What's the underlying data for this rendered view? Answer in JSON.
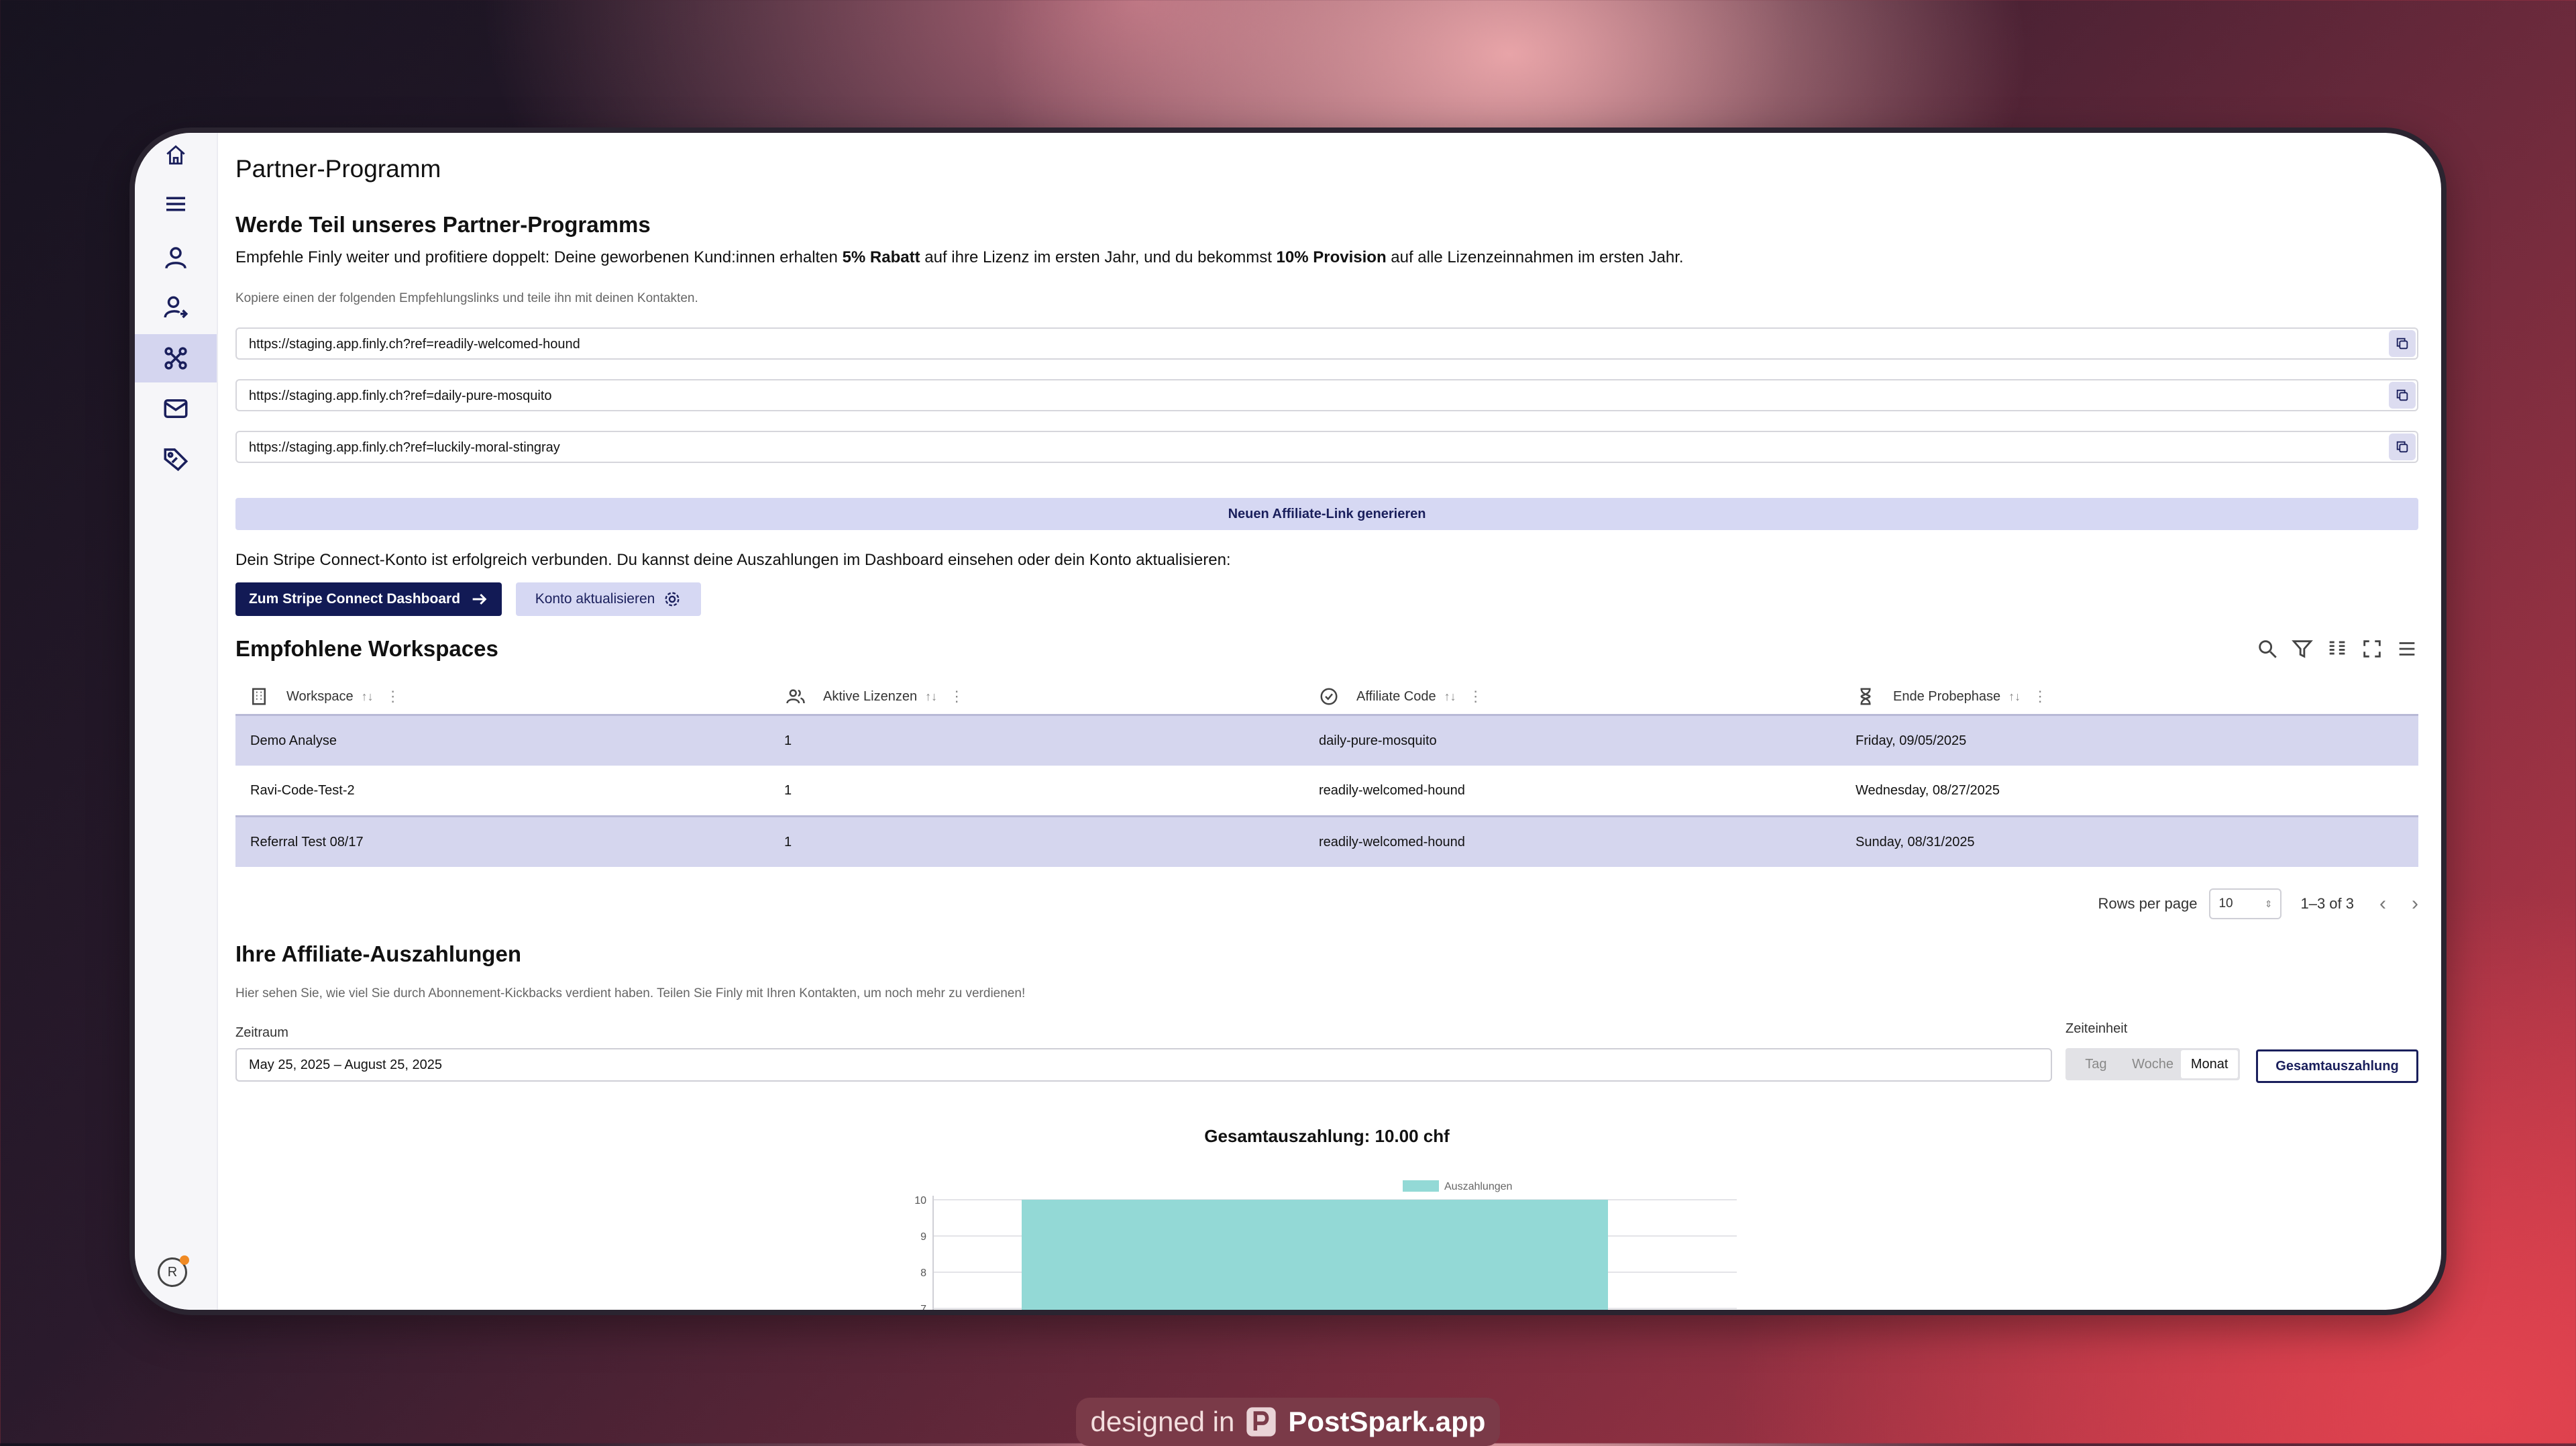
{
  "page": {
    "title": "Partner-Programm",
    "join_heading": "Werde Teil unseres Partner-Programms",
    "intro_pre": "Empfehle Finly weiter und profitiere doppelt: Deine geworbenen Kund:innen erhalten ",
    "intro_bold1": "5% Rabatt",
    "intro_mid": " auf ihre Lizenz im ersten Jahr, und du bekommst ",
    "intro_bold2": "10% Provision",
    "intro_post": " auf alle Lizenzeinnahmen im ersten Jahr.",
    "copy_hint": "Kopiere einen der folgenden Empfehlungslinks und teile ihn mit deinen Kontakten.",
    "links": [
      "https://staging.app.finly.ch?ref=readily-welcomed-hound",
      "https://staging.app.finly.ch?ref=daily-pure-mosquito",
      "https://staging.app.finly.ch?ref=luckily-moral-stingray"
    ],
    "generate_label": "Neuen Affiliate-Link generieren",
    "stripe_text": "Dein Stripe Connect-Konto ist erfolgreich verbunden. Du kannst deine Auszahlungen im Dashboard einsehen oder dein Konto aktualisieren:",
    "stripe_dashboard_label": "Zum Stripe Connect Dashboard",
    "update_account_label": "Konto aktualisieren"
  },
  "table": {
    "heading": "Empfohlene Workspaces",
    "columns": [
      "Workspace",
      "Aktive Lizenzen",
      "Affiliate Code",
      "Ende Probephase"
    ],
    "rows": [
      [
        "Demo Analyse",
        "1",
        "daily-pure-mosquito",
        "Friday, 09/05/2025"
      ],
      [
        "Ravi-Code-Test-2",
        "1",
        "readily-welcomed-hound",
        "Wednesday, 08/27/2025"
      ],
      [
        "Referral Test 08/17",
        "1",
        "readily-welcomed-hound",
        "Sunday, 08/31/2025"
      ]
    ],
    "rows_per_page_label": "Rows per page",
    "rows_per_page_value": "10",
    "range_text": "1–3 of 3"
  },
  "payouts": {
    "heading": "Ihre Affiliate-Auszahlungen",
    "description": "Hier sehen Sie, wie viel Sie durch Abonnement-Kickbacks verdient haben. Teilen Sie Finly mit Ihren Kontakten, um noch mehr zu verdienen!",
    "range_label": "Zeitraum",
    "range_value": "May 25, 2025 – August 25, 2025",
    "unit_label": "Zeiteinheit",
    "units": [
      "Tag",
      "Woche",
      "Monat"
    ],
    "active_unit": "Monat",
    "total_button": "Gesamtauszahlung",
    "chart_title": "Gesamtauszahlung: 10.00 chf"
  },
  "chart_data": {
    "type": "bar",
    "categories": [
      ""
    ],
    "series": [
      {
        "name": "Auszahlungen",
        "values": [
          10
        ]
      }
    ],
    "y_ticks": [
      "10",
      "9",
      "8",
      "7"
    ],
    "ylim": [
      7,
      10
    ],
    "legend_position": "top",
    "color": "#93d9d6"
  },
  "user": {
    "avatar_initial": "R"
  },
  "watermark": {
    "prefix": "designed in",
    "brand": "PostSpark.app"
  },
  "colors": {
    "primary": "#121a55",
    "accent_light": "#d6d8f3",
    "bar": "#93d9d6"
  }
}
